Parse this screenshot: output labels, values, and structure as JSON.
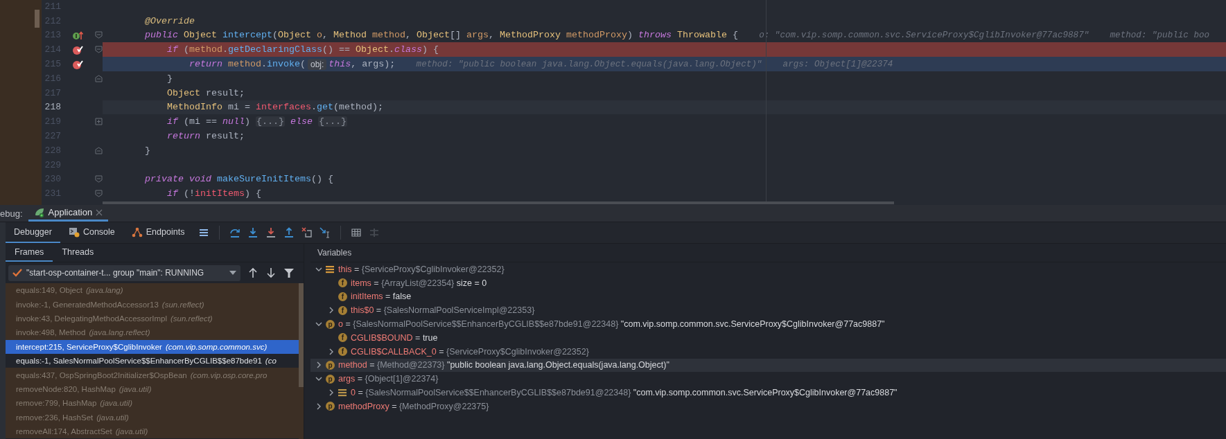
{
  "editor": {
    "lines": [
      {
        "number": "211"
      },
      {
        "number": "212",
        "segments": [
          {
            "kind": "code",
            "tokens": [
              {
                "kind": "ann",
                "t": "    @Override"
              }
            ]
          }
        ]
      },
      {
        "number": "213",
        "gutter": {
          "kind": "implements"
        },
        "fold": {
          "kind": "open"
        },
        "segments": [
          {
            "kind": "code",
            "tokens": [
              {
                "kind": "kw",
                "t": "    public"
              },
              {
                "kind": "type",
                "t": " Object"
              },
              {
                "kind": "fn",
                "t": " intercept"
              },
              {
                "kind": "p",
                "t": "("
              },
              {
                "kind": "type",
                "t": "Object"
              },
              {
                "kind": "param",
                "t": " o"
              },
              {
                "kind": "p",
                "t": ", "
              },
              {
                "kind": "type",
                "t": "Method"
              },
              {
                "kind": "param",
                "t": " method"
              },
              {
                "kind": "p",
                "t": ", "
              },
              {
                "kind": "type",
                "t": "Object"
              },
              {
                "kind": "p",
                "t": "[] "
              },
              {
                "kind": "param",
                "t": "args"
              },
              {
                "kind": "p",
                "t": ", "
              },
              {
                "kind": "type",
                "t": "MethodProxy"
              },
              {
                "kind": "param",
                "t": " methodProxy"
              },
              {
                "kind": "p",
                "t": ") "
              },
              {
                "kind": "kw",
                "t": "throws"
              },
              {
                "kind": "type",
                "t": " Throwable"
              },
              {
                "kind": "p",
                "t": " {"
              }
            ]
          },
          {
            "kind": "value",
            "text": "o: \"com.vip.somp.common.svc.ServiceProxy$CglibInvoker@77ac9887\""
          },
          {
            "kind": "value",
            "text": "method: \"public boo"
          }
        ]
      },
      {
        "number": "214",
        "highlight": {
          "kind": "breakpoint"
        },
        "gutter": {
          "kind": "breakpoint"
        },
        "fold": {
          "kind": "open"
        },
        "segments": [
          {
            "kind": "code",
            "tokens": [
              {
                "kind": "kw",
                "t": "        if"
              },
              {
                "kind": "p",
                "t": " ("
              },
              {
                "kind": "param",
                "t": "method"
              },
              {
                "kind": "p",
                "t": "."
              },
              {
                "kind": "fn",
                "t": "getDeclaringClass"
              },
              {
                "kind": "p",
                "t": "() == "
              },
              {
                "kind": "type",
                "t": "Object"
              },
              {
                "kind": "p",
                "t": "."
              },
              {
                "kind": "kw",
                "t": "class"
              },
              {
                "kind": "p",
                "t": ") {"
              }
            ]
          }
        ]
      },
      {
        "number": "215",
        "highlight": {
          "kind": "execution"
        },
        "gutter": {
          "kind": "breakpoint"
        },
        "segments": [
          {
            "kind": "code",
            "tokens": [
              {
                "kind": "kw",
                "t": "            return"
              },
              {
                "kind": "param",
                "t": " method"
              },
              {
                "kind": "p",
                "t": "."
              },
              {
                "kind": "fn",
                "t": "invoke"
              },
              {
                "kind": "p",
                "t": "("
              }
            ]
          },
          {
            "kind": "hint",
            "text": "obj:"
          },
          {
            "kind": "code",
            "tokens": [
              {
                "kind": "kw",
                "t": "this"
              },
              {
                "kind": "p",
                "t": ", args);"
              }
            ]
          },
          {
            "kind": "value",
            "text": "method: \"public boolean java.lang.Object.equals(java.lang.Object)\""
          },
          {
            "kind": "value",
            "text": "args: Object[1]@22374"
          }
        ]
      },
      {
        "number": "216",
        "fold": {
          "kind": "close"
        },
        "segments": [
          {
            "kind": "code",
            "tokens": [
              {
                "kind": "p",
                "t": "        }"
              }
            ]
          }
        ]
      },
      {
        "number": "217",
        "segments": [
          {
            "kind": "code",
            "tokens": [
              {
                "kind": "type",
                "t": "        Object"
              },
              {
                "kind": "p",
                "t": " result;"
              }
            ]
          }
        ]
      },
      {
        "number": "218",
        "highlight": {
          "kind": "caret"
        },
        "segments": [
          {
            "kind": "code",
            "tokens": [
              {
                "kind": "type",
                "t": "        MethodInfo"
              },
              {
                "kind": "p",
                "t": " mi = "
              },
              {
                "kind": "field",
                "t": "interfaces"
              },
              {
                "kind": "p",
                "t": "."
              },
              {
                "kind": "fn",
                "t": "get"
              },
              {
                "kind": "p",
                "t": "(method);"
              }
            ]
          }
        ]
      },
      {
        "number": "219",
        "fold": {
          "kind": "collapsed"
        },
        "segments": [
          {
            "kind": "code",
            "tokens": [
              {
                "kind": "kw",
                "t": "        if"
              },
              {
                "kind": "p",
                "t": " (mi == "
              },
              {
                "kind": "kw",
                "t": "null"
              },
              {
                "kind": "p",
                "t": ")"
              }
            ]
          },
          {
            "kind": "fold",
            "text": "{...}"
          },
          {
            "kind": "code",
            "tokens": [
              {
                "kind": "kw",
                "t": "else"
              }
            ]
          },
          {
            "kind": "fold",
            "text": "{...}"
          }
        ]
      },
      {
        "number": "227",
        "segments": [
          {
            "kind": "code",
            "tokens": [
              {
                "kind": "kw",
                "t": "        return"
              },
              {
                "kind": "p",
                "t": " result;"
              }
            ]
          }
        ]
      },
      {
        "number": "228",
        "fold": {
          "kind": "close"
        },
        "segments": [
          {
            "kind": "code",
            "tokens": [
              {
                "kind": "p",
                "t": "    }"
              }
            ]
          }
        ]
      },
      {
        "number": "229"
      },
      {
        "number": "230",
        "fold": {
          "kind": "open"
        },
        "segments": [
          {
            "kind": "code",
            "tokens": [
              {
                "kind": "kw",
                "t": "    private"
              },
              {
                "kind": "kw",
                "t": " void"
              },
              {
                "kind": "fn",
                "t": " makeSureInitItems"
              },
              {
                "kind": "p",
                "t": "() {"
              }
            ]
          }
        ]
      },
      {
        "number": "231",
        "fold": {
          "kind": "open"
        },
        "segments": [
          {
            "kind": "code",
            "tokens": [
              {
                "kind": "kw",
                "t": "        if"
              },
              {
                "kind": "p",
                "t": " (!"
              },
              {
                "kind": "field",
                "t": "initItems"
              },
              {
                "kind": "p",
                "t": ") {"
              }
            ]
          }
        ]
      }
    ]
  },
  "debug_window": {
    "title": "ebug:",
    "tabs": [
      {
        "label": "Application",
        "selected": true
      }
    ]
  },
  "toolbar": {
    "tabs": [
      {
        "label": "Debugger",
        "selected": true,
        "kind": "plain"
      },
      {
        "label": "Console",
        "selected": false,
        "kind": "console"
      },
      {
        "label": "Endpoints",
        "selected": false,
        "kind": "endpoints"
      }
    ]
  },
  "frames_panel": {
    "tabs": [
      {
        "label": "Frames",
        "selected": true
      },
      {
        "label": "Threads",
        "selected": false
      }
    ],
    "thread": "\"start-osp-container-t... group \"main\": RUNNING",
    "frames": [
      {
        "method": "equals:149, Object",
        "package": "(java.lang)",
        "dimmed": true,
        "selected": false
      },
      {
        "method": "invoke:-1, GeneratedMethodAccessor13",
        "package": "(sun.reflect)",
        "dimmed": true,
        "selected": false
      },
      {
        "method": "invoke:43, DelegatingMethodAccessorImpl",
        "package": "(sun.reflect)",
        "dimmed": true,
        "selected": false
      },
      {
        "method": "invoke:498, Method",
        "package": "(java.lang.reflect)",
        "dimmed": true,
        "selected": false
      },
      {
        "method": "intercept:215, ServiceProxy$CglibInvoker",
        "package": "(com.vip.somp.common.svc)",
        "dimmed": false,
        "selected": true
      },
      {
        "method": "equals:-1, SalesNormalPoolService$$EnhancerByCGLIB$$e87bde91",
        "package": "(co",
        "dimmed": false,
        "selected": false
      },
      {
        "method": "equals:437, OspSpringBoot2Initializer$OspBean",
        "package": "(com.vip.osp.core.pro",
        "dimmed": true,
        "selected": false
      },
      {
        "method": "removeNode:820, HashMap",
        "package": "(java.util)",
        "dimmed": true,
        "selected": false
      },
      {
        "method": "remove:799, HashMap",
        "package": "(java.util)",
        "dimmed": true,
        "selected": false
      },
      {
        "method": "remove:236, HashSet",
        "package": "(java.util)",
        "dimmed": true,
        "selected": false
      },
      {
        "method": "removeAll:174, AbstractSet",
        "package": "(java.util)",
        "dimmed": true,
        "selected": false
      }
    ]
  },
  "variables_panel": {
    "title": "Variables",
    "variables": [
      {
        "kind": "object",
        "name": "this",
        "operator": "=",
        "type": "{ServiceProxy$CglibInvoker@22352}",
        "expanded": true,
        "selected": false,
        "children": [
          {
            "kind": "field",
            "badge": "f",
            "name": "items",
            "operator": "=",
            "type": "{ArrayList@22354}",
            "value": "size = 0",
            "selected": false
          },
          {
            "kind": "field",
            "badge": "f",
            "name": "initItems",
            "operator": "=",
            "value": "false",
            "selected": false
          },
          {
            "kind": "field",
            "badge": "f",
            "name": "this$0",
            "operator": "=",
            "type": "{SalesNormalPoolServiceImpl@22353}",
            "expanded": false,
            "selected": false
          }
        ]
      },
      {
        "kind": "param",
        "badge": "p",
        "name": "o",
        "operator": "=",
        "type": "{SalesNormalPoolService$$EnhancerByCGLIB$$e87bde91@22348}",
        "value": "\"com.vip.somp.common.svc.ServiceProxy$CglibInvoker@77ac9887\"",
        "expanded": true,
        "selected": false,
        "children": [
          {
            "kind": "field",
            "badge": "f",
            "name": "CGLIB$BOUND",
            "operator": "=",
            "value": "true",
            "selected": false
          },
          {
            "kind": "field",
            "badge": "f",
            "name": "CGLIB$CALLBACK_0",
            "operator": "=",
            "type": "{ServiceProxy$CglibInvoker@22352}",
            "expanded": false,
            "selected": false
          }
        ]
      },
      {
        "kind": "param",
        "badge": "p",
        "name": "method",
        "operator": "=",
        "type": "{Method@22373}",
        "value": "\"public boolean java.lang.Object.equals(java.lang.Object)\"",
        "expanded": false,
        "selected": true
      },
      {
        "kind": "param",
        "badge": "p",
        "name": "args",
        "operator": "=",
        "type": "{Object[1]@22374}",
        "expanded": true,
        "selected": false,
        "children": [
          {
            "kind": "element",
            "name": "0",
            "operator": "=",
            "type": "{SalesNormalPoolService$$EnhancerByCGLIB$$e87bde91@22348}",
            "value": "\"com.vip.somp.common.svc.ServiceProxy$CglibInvoker@77ac9887\"",
            "expanded": false,
            "selected": false
          }
        ]
      },
      {
        "kind": "param",
        "badge": "p",
        "name": "methodProxy",
        "operator": "=",
        "type": "{MethodProxy@22375}",
        "expanded": false,
        "selected": false
      }
    ]
  }
}
